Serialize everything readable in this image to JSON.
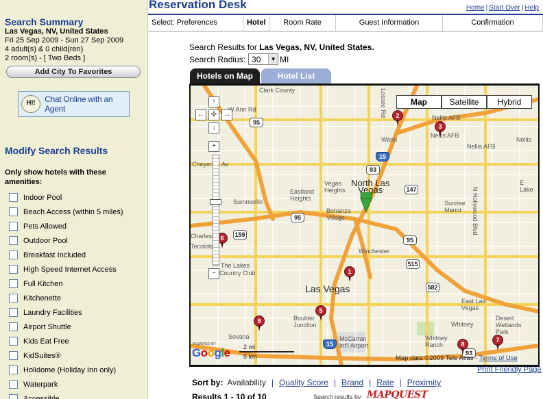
{
  "app": {
    "title": "Reservation Desk",
    "links": [
      "Home",
      "Start Over",
      "Help"
    ]
  },
  "steps": [
    {
      "label": "Select: Preferences",
      "active": false
    },
    {
      "label": "Hotel",
      "active": true
    },
    {
      "label": "Room Rate",
      "active": false
    },
    {
      "label": "Guest Information",
      "active": false
    },
    {
      "label": "Confirmation",
      "active": false
    }
  ],
  "summary": {
    "title": "Search Summary",
    "location": "Las Vegas, NV, United States",
    "dates": "Fri 25 Sep 2009 - Sun 27 Sep 2009",
    "guests": "4 adult(s) & 0 child(ren)",
    "rooms": "2 room(s) - [ Two Beds ]",
    "favorites_button": "Add City To Favorites",
    "chat_button": "Chat Online with an Agent",
    "chat_bubble": "HI!"
  },
  "modify": {
    "title": "Modify Search Results",
    "heading": "Only show hotels with these amenities:",
    "amenities": [
      "Indoor Pool",
      "Beach Access (within 5 miles)",
      "Pets Allowed",
      "Outdoor Pool",
      "Breakfast Included",
      "High Speed Internet Access",
      "Full Kitchen",
      "Kitchenette",
      "Laundry Facilities",
      "Airport Shuttle",
      "Kids Eat Free",
      "KidSuites®",
      "Holidome (Holiday Inn only)",
      "Waterpark",
      "Accessible"
    ]
  },
  "search": {
    "results_prefix": "Search Results for",
    "results_location": "Las Vegas, NV, United States.",
    "radius_label": "Search Radius:",
    "radius_value": "30",
    "radius_unit": "MI"
  },
  "tabs": {
    "map": "Hotels on Map",
    "list": "Hotel List"
  },
  "map": {
    "type_buttons": [
      "Map",
      "Satellite",
      "Hybrid"
    ],
    "selected_type": "Map",
    "labels": {
      "north_las_vegas": "North Las\nVegas",
      "las_vegas": "Las Vegas",
      "clark_county": "Clark County",
      "w_ann_rd": "W Ann Rd",
      "nellis_afb_top": "Nellis AFB",
      "nellis_afb": "Nellis AFB",
      "nellis_afb_right": "Nellis AFB",
      "nellis_right2": "Nellis",
      "wann": "Wann",
      "e_lake": "E Lake",
      "cheyenne": "Cheyenne Av",
      "summerlin": "Summerlin",
      "vegas_heights": "Vegas\nHeights",
      "eastland_heights": "Eastland\nHeights",
      "bonanza_village": "Bonanza\nVillage",
      "sunrise_manor": "Sunrise\nManor",
      "winchester": "Winchester",
      "charleston": "Charleston",
      "tecolote": "Tecolote",
      "the_lakes": "The Lakes",
      "country_club": "Country Club",
      "east_las_vegas": "East Las\nVegas",
      "boulder_junction": "Boulder\nJunction",
      "mccarran": "McCarran\nInt'l Airport",
      "whitney": "Whitney",
      "whitney_ranch": "Whitney\nRanch",
      "desert_wetlands": "Desert\nWetlands\nPark",
      "sovana": "Sovana",
      "lossee": "Lossee Rd",
      "hollywood": "N Hollywood Blvd"
    },
    "shields": [
      "95",
      "15",
      "93",
      "147",
      "95",
      "95",
      "159",
      "515",
      "582",
      "15",
      "93"
    ],
    "hotel_pins": [
      "1",
      "2",
      "3",
      "5",
      "6",
      "7",
      "8",
      "9"
    ],
    "scale_mi": "2 mi",
    "scale_km": "5 km",
    "powered_by": "POWERED BY",
    "google": "Google",
    "copyright": "Map data ©2009 Tele Atlas - ",
    "terms": "Terms of Use"
  },
  "print_link": "Print Friendly Page",
  "sort": {
    "label": "Sort by:",
    "options": [
      "Availability",
      "Quality Score",
      "Brand",
      "Rate",
      "Proximity"
    ],
    "current": "Availability"
  },
  "results_count": "Results 1 - 10 of 10",
  "search_by": "Search results by",
  "mapquest": "MAPQUEST"
}
